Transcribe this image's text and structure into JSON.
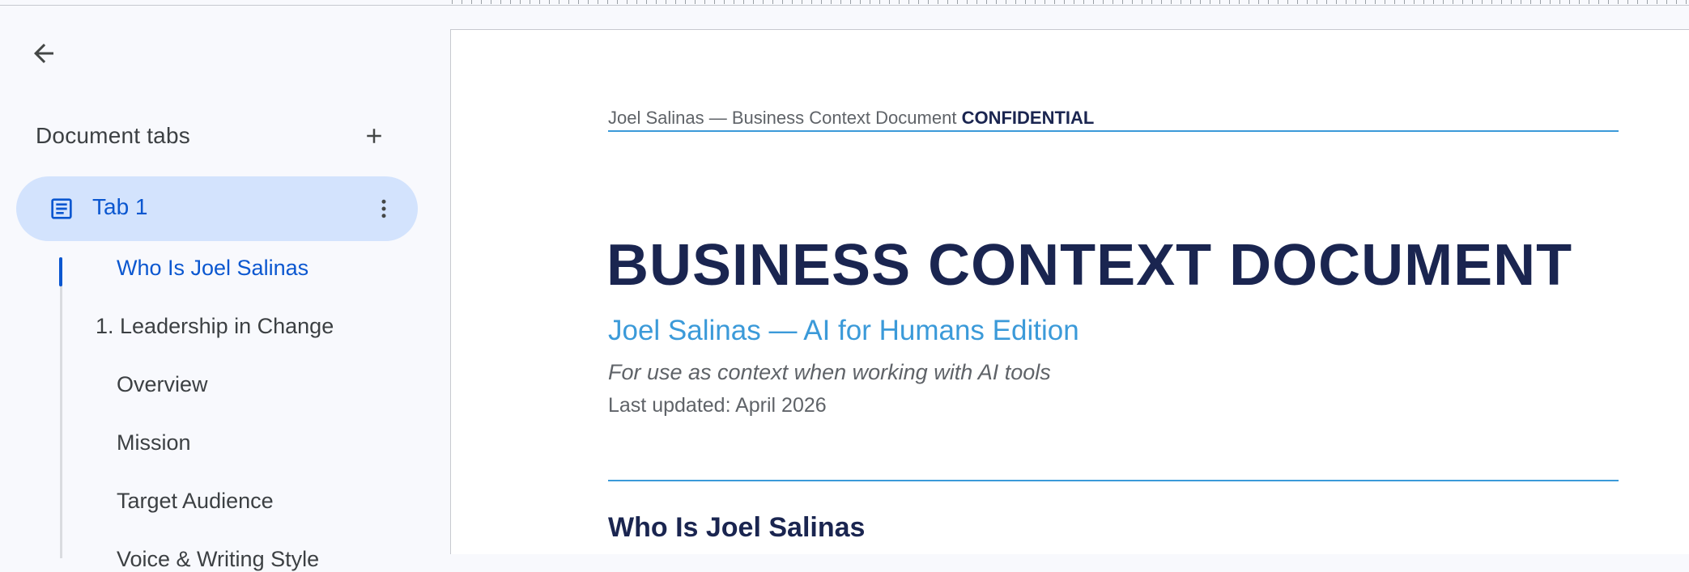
{
  "sidebar": {
    "heading": "Document tabs",
    "tab": {
      "label": "Tab 1"
    },
    "outline": [
      {
        "label": "Who Is Joel Salinas",
        "active": true
      },
      {
        "label": "1. Leadership in Change",
        "active": false
      },
      {
        "label": "Overview",
        "active": false
      },
      {
        "label": "Mission",
        "active": false
      },
      {
        "label": "Target Audience",
        "active": false
      },
      {
        "label": "Voice & Writing Style",
        "active": false
      }
    ]
  },
  "document": {
    "header_name": "Joel Salinas — Business Context Document",
    "header_badge": "CONFIDENTIAL",
    "title": "BUSINESS CONTEXT DOCUMENT",
    "subtitle": "Joel Salinas — AI for Humans Edition",
    "italic_line": "For use as context when working with AI tools",
    "last_updated": "Last updated: April 2026",
    "section_heading": "Who Is Joel Salinas"
  },
  "colors": {
    "accent_blue": "#0b57d0",
    "active_tab_bg": "#d3e3fd",
    "navy": "#1a2550",
    "link_blue": "#3b9ad9"
  },
  "icons": [
    "back-arrow-icon",
    "plus-icon",
    "document-icon",
    "more-vert-icon"
  ]
}
